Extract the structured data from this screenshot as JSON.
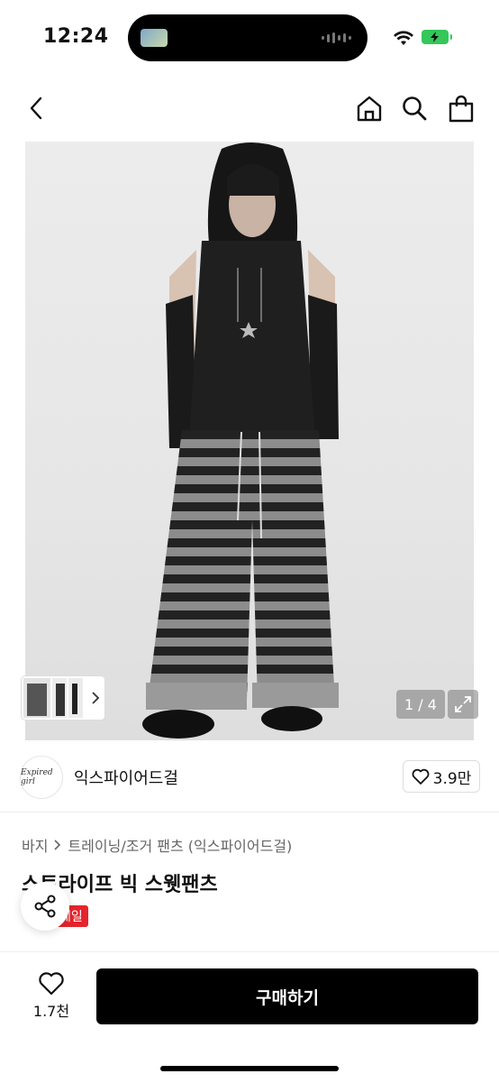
{
  "status": {
    "time": "12:24"
  },
  "nav": {
    "back_icon": "chevron-left-icon",
    "home_icon": "home-icon",
    "search_icon": "search-icon",
    "bag_icon": "shopping-bag-icon"
  },
  "gallery": {
    "counter": "1 / 4",
    "expand_icon": "expand-icon"
  },
  "shop": {
    "name": "익스파이어드걸",
    "logo_text": "Expired girl",
    "likes": "3.9만"
  },
  "breadcrumb": {
    "category": "바지",
    "sub": "트레이닝/조거 팬츠 (익스파이어드걸)"
  },
  "product": {
    "title": "스트라이프 빅 스웻팬츠",
    "badge": "세일"
  },
  "bottom": {
    "wish_count": "1.7천",
    "buy_label": "구매하기"
  },
  "colors": {
    "sale": "#e5242b",
    "buy_bg": "#000000"
  }
}
